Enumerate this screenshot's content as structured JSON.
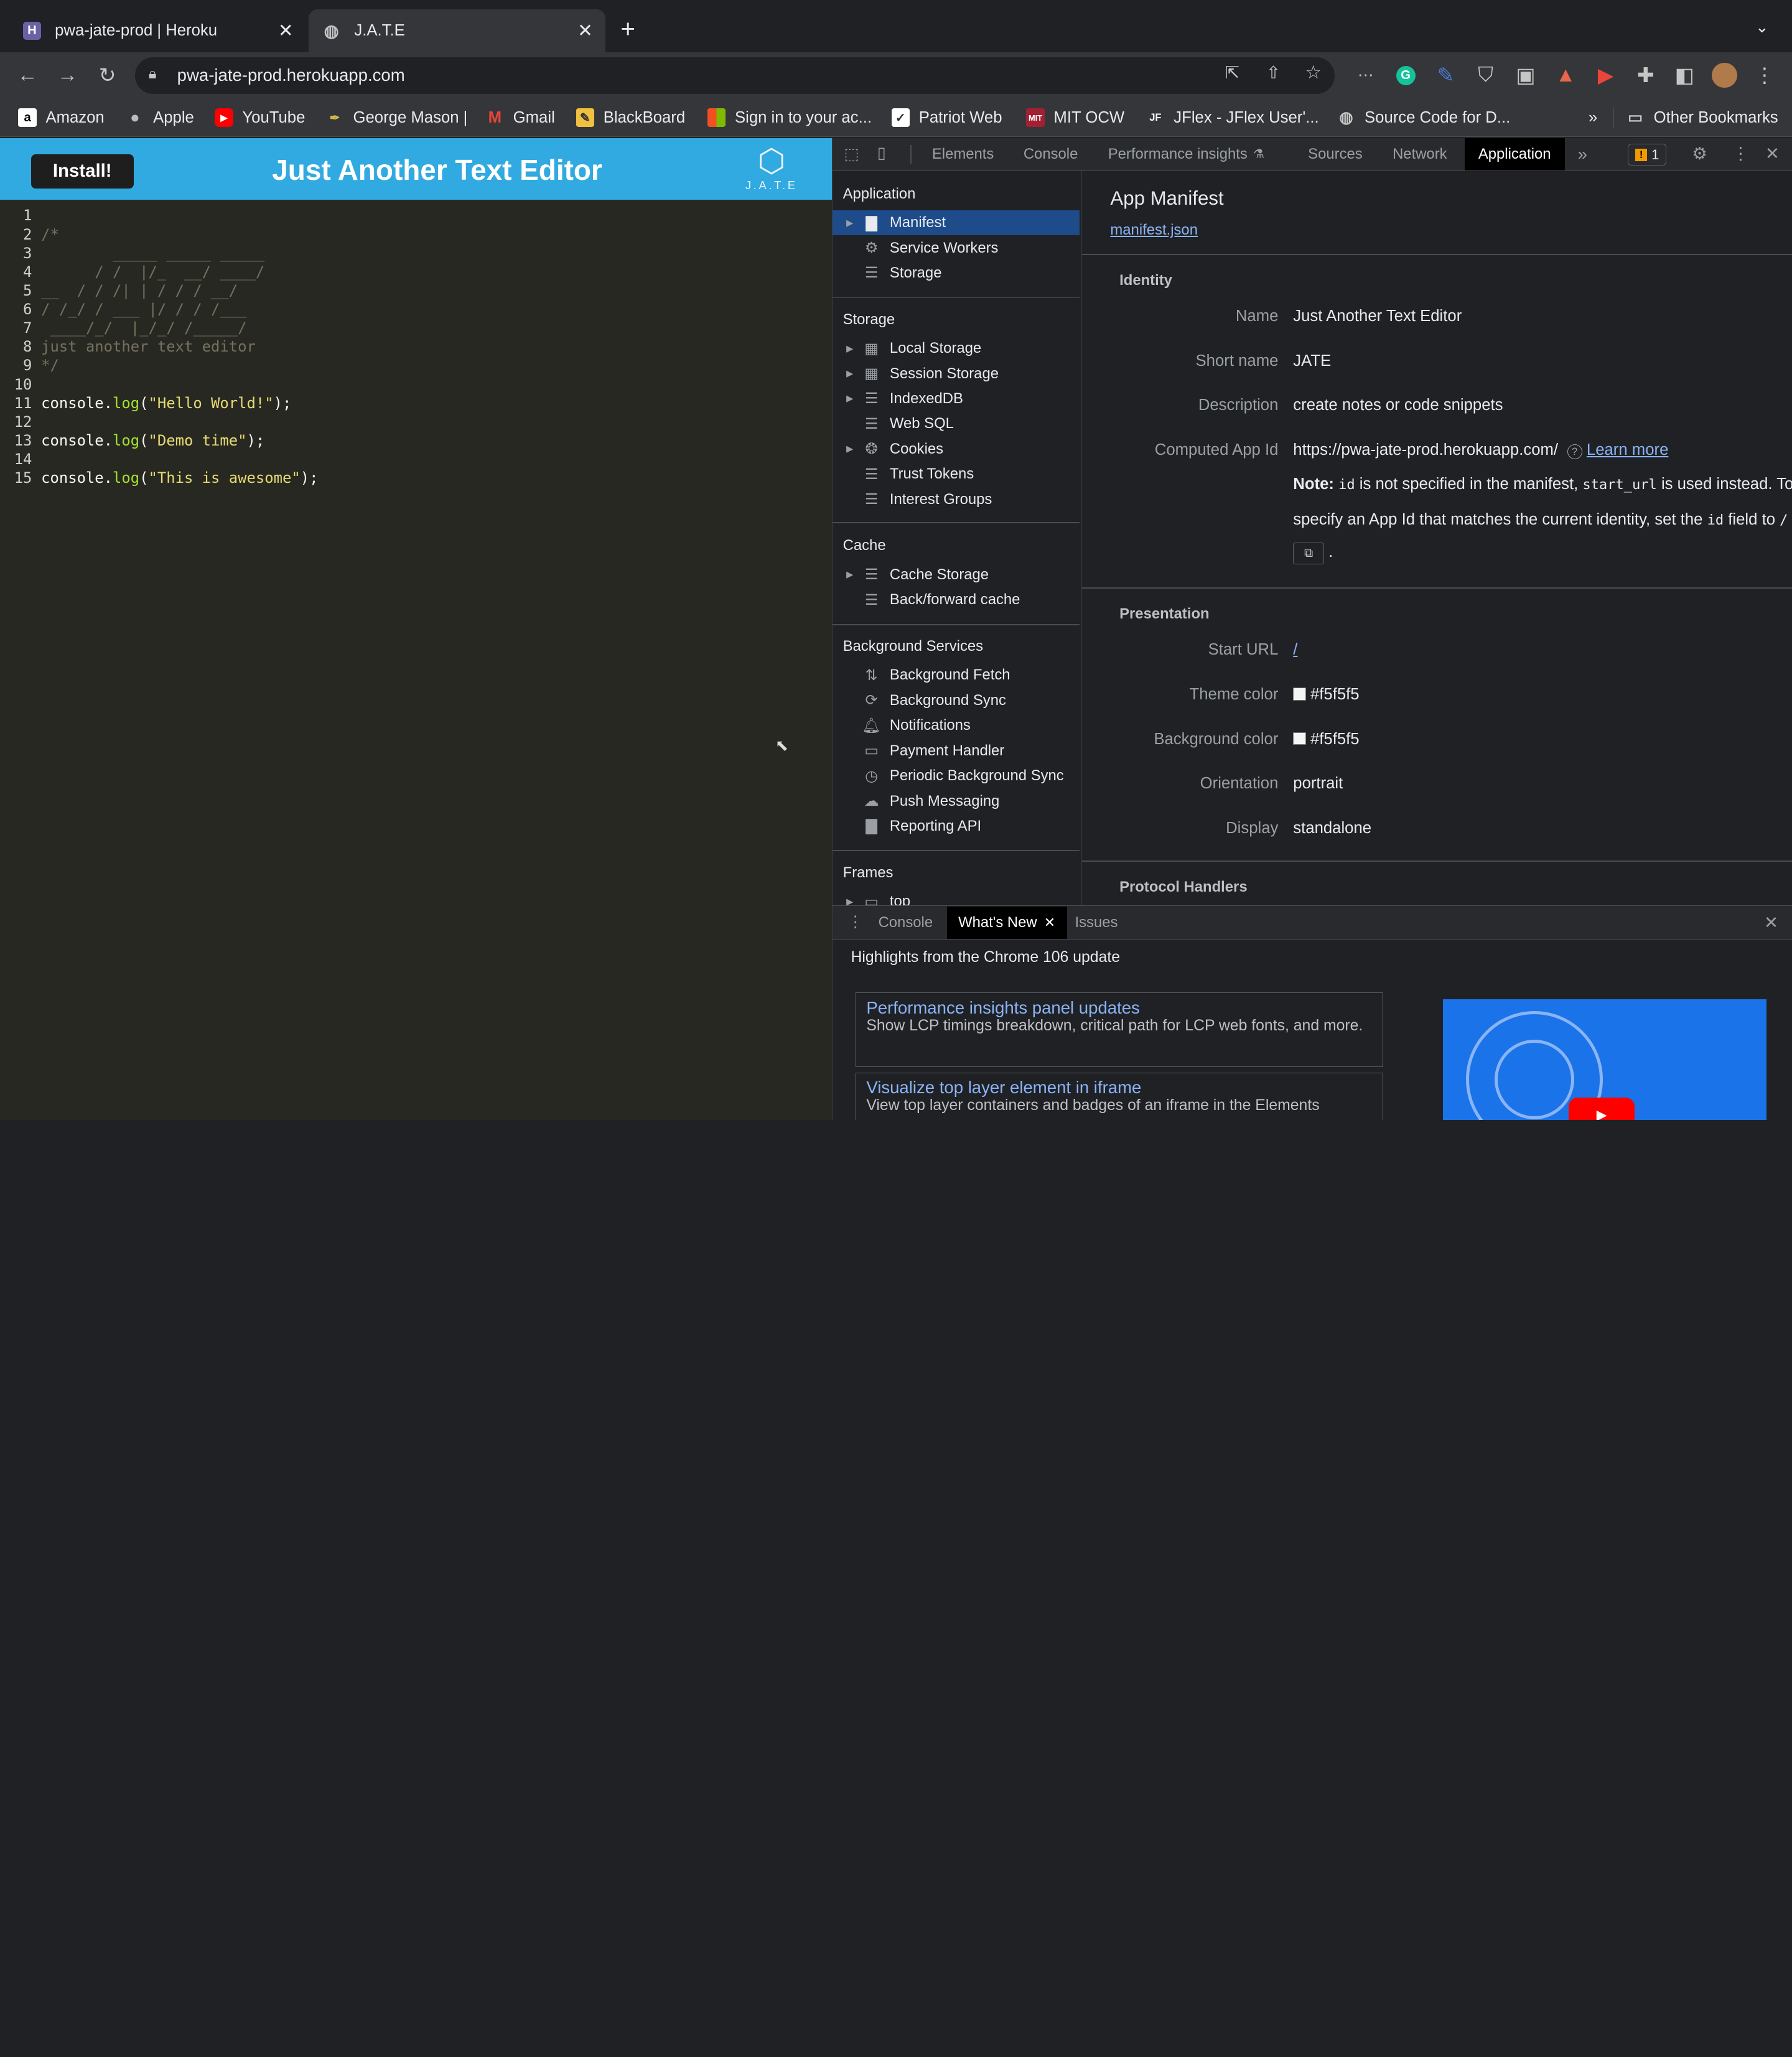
{
  "browser": {
    "tabs": [
      {
        "title": "pwa-jate-prod | Heroku",
        "favicon": "heroku-icon"
      },
      {
        "title": "J.A.T.E",
        "favicon": "globe-icon"
      }
    ],
    "url": "pwa-jate-prod.herokuapp.com",
    "bookmarks": [
      {
        "label": "Amazon",
        "icon": "amazon-icon"
      },
      {
        "label": "Apple",
        "icon": "apple-icon"
      },
      {
        "label": "YouTube",
        "icon": "youtube-icon"
      },
      {
        "label": "George Mason |",
        "icon": "gmu-icon"
      },
      {
        "label": "Gmail",
        "icon": "gmail-icon"
      },
      {
        "label": "BlackBoard",
        "icon": "blackboard-icon"
      },
      {
        "label": "Sign in to your ac...",
        "icon": "microsoft-icon"
      },
      {
        "label": "Patriot Web",
        "icon": "patriotweb-icon"
      },
      {
        "label": "MIT OCW",
        "icon": "mitocw-icon"
      },
      {
        "label": "JFlex - JFlex User'...",
        "icon": "jflex-icon"
      },
      {
        "label": "Source Code for D...",
        "icon": "globe-icon"
      }
    ],
    "other_bookmarks": "Other Bookmarks"
  },
  "app": {
    "install_label": "Install!",
    "title": "Just Another Text Editor",
    "logo_text": "J.A.T.E",
    "code_lines": [
      {
        "n": "1",
        "t": ""
      },
      {
        "n": "2",
        "t": "/*"
      },
      {
        "n": "3",
        "t": "        _____ _____ _____"
      },
      {
        "n": "4",
        "t": "      / /  |/_  __/ ____/"
      },
      {
        "n": "5",
        "t": "__  / / /| | / / / __/"
      },
      {
        "n": "6",
        "t": "/ /_/ / ___ |/ / / /___"
      },
      {
        "n": "7",
        "t": " ____/_/  |_/_/ /_____/"
      },
      {
        "n": "8",
        "t": "just another text editor"
      },
      {
        "n": "9",
        "t": "*/"
      },
      {
        "n": "10",
        "t": ""
      },
      {
        "n": "11",
        "t": "console.log(\"Hello World!\");"
      },
      {
        "n": "12",
        "t": ""
      },
      {
        "n": "13",
        "t": "console.log(\"Demo time\");"
      },
      {
        "n": "14",
        "t": ""
      },
      {
        "n": "15",
        "t": "console.log(\"This is awesome\");"
      }
    ],
    "calls": [
      {
        "obj": "console.",
        "fn": "log",
        "open": "(",
        "str": "\"Hello World!\"",
        "close": ");"
      },
      {
        "obj": "console.",
        "fn": "log",
        "open": "(",
        "str": "\"Demo time\"",
        "close": ");"
      },
      {
        "obj": "console.",
        "fn": "log",
        "open": "(",
        "str": "\"This is awesome\"",
        "close": ");"
      }
    ]
  },
  "devtools": {
    "tabs": [
      "Elements",
      "Console",
      "Performance insights",
      "Sources",
      "Network",
      "Application"
    ],
    "issues_count": "1",
    "sidebar": {
      "application_header": "Application",
      "application_items": [
        "Manifest",
        "Service Workers",
        "Storage"
      ],
      "storage_header": "Storage",
      "storage_items": [
        "Local Storage",
        "Session Storage",
        "IndexedDB",
        "Web SQL",
        "Cookies",
        "Trust Tokens",
        "Interest Groups"
      ],
      "cache_header": "Cache",
      "cache_items": [
        "Cache Storage",
        "Back/forward cache"
      ],
      "bg_header": "Background Services",
      "bg_items": [
        "Background Fetch",
        "Background Sync",
        "Notifications",
        "Payment Handler",
        "Periodic Background Sync",
        "Push Messaging",
        "Reporting API"
      ],
      "frames_header": "Frames",
      "frames_items": [
        "top"
      ]
    },
    "manifest": {
      "title": "App Manifest",
      "link": "manifest.json",
      "identity_header": "Identity",
      "name_label": "Name",
      "name": "Just Another Text Editor",
      "short_name_label": "Short name",
      "short_name": "JATE",
      "description_label": "Description",
      "description": "create notes or code snippets",
      "app_id_label": "Computed App Id",
      "app_id": "https://pwa-jate-prod.herokuapp.com/",
      "learn_more": "Learn more",
      "note_bold": "Note:",
      "note_code1": "id",
      "note_text1": " is not specified in the manifest, ",
      "note_code2": "start_url",
      "note_text2": " is used instead. To",
      "note_line2a": "specify an App Id that matches the current identity, set the ",
      "note_code3": "id",
      "note_line2b": " field to ",
      "note_code4": "/",
      "presentation_header": "Presentation",
      "start_url_label": "Start URL",
      "start_url": "/",
      "theme_label": "Theme color",
      "theme": "#f5f5f5",
      "bg_label": "Background color",
      "bg": "#f5f5f5",
      "orientation_label": "Orientation",
      "orientation": "portrait",
      "display_label": "Display",
      "display": "standalone",
      "protocol_header": "Protocol Handlers"
    },
    "drawer": {
      "tabs": [
        "Console",
        "What's New",
        "Issues"
      ],
      "highlight": "Highlights from the Chrome 106 update",
      "cards": [
        {
          "title": "Performance insights panel updates",
          "desc": "Show LCP timings breakdown, critical path for LCP web fonts, and more."
        },
        {
          "title": "Visualize top layer element in iframe",
          "desc": "View top layer containers and badges of an iframe in the Elements"
        }
      ]
    }
  },
  "colors": {
    "app_header": "#31a9e1",
    "editor_bg": "#272822",
    "selection": "#1e4b8a"
  }
}
